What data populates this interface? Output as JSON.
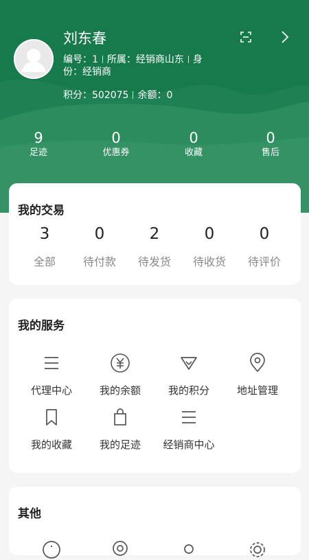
{
  "profile": {
    "name": "刘东春",
    "id_label": "编号：1",
    "belongs_label": "所属：经销商山东",
    "identity_label_a": "身",
    "identity_label_b": "份：经销商",
    "points_label": "积分：502075",
    "balance_label": "余额：0",
    "icons": [
      "scan-icon",
      "chevron-right-icon"
    ]
  },
  "stats": [
    {
      "num": "9",
      "label": "足迹"
    },
    {
      "num": "0",
      "label": "优惠券"
    },
    {
      "num": "0",
      "label": "收藏"
    },
    {
      "num": "0",
      "label": "售后"
    }
  ],
  "trade": {
    "title": "我的交易",
    "items": [
      {
        "num": "3",
        "label": "全部"
      },
      {
        "num": "0",
        "label": "待付款"
      },
      {
        "num": "2",
        "label": "待发货"
      },
      {
        "num": "0",
        "label": "待收货"
      },
      {
        "num": "0",
        "label": "待评价"
      }
    ]
  },
  "services": {
    "title": "我的服务",
    "items": [
      {
        "label": "代理中心",
        "icon": "list-icon"
      },
      {
        "label": "我的余额",
        "icon": "yen-icon"
      },
      {
        "label": "我的积分",
        "icon": "diamond-icon"
      },
      {
        "label": "地址管理",
        "icon": "location-icon"
      },
      {
        "label": "我的收藏",
        "icon": "bookmark-icon"
      },
      {
        "label": "我的足迹",
        "icon": "bag-icon"
      },
      {
        "label": "经销商中心",
        "icon": "list-icon"
      }
    ]
  },
  "other": {
    "title": "其他",
    "icons": [
      "info-icon",
      "support-icon",
      "search-icon",
      "settings-icon"
    ]
  },
  "colors": {
    "brand": "#177a4c",
    "wave": "#2a8a5d",
    "text_muted": "#888888"
  }
}
